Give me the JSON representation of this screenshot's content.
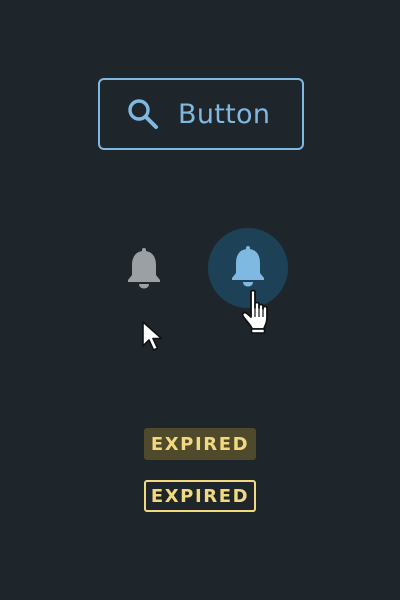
{
  "search_button": {
    "label": "Button",
    "icon": "search-icon",
    "color": "#7fb9e2"
  },
  "bells": [
    {
      "icon": "bell-icon",
      "state": "default",
      "color": "#9aa0a4"
    },
    {
      "icon": "bell-icon",
      "state": "hover",
      "color": "#7fb9e2",
      "highlight": "#1d4258"
    }
  ],
  "cursors": [
    {
      "icon": "arrow-pointer-icon"
    },
    {
      "icon": "hand-pointer-icon"
    }
  ],
  "badges": [
    {
      "label": "EXPIRED",
      "style": "filled",
      "color": "#f0d97e",
      "background": "#4f4a2c"
    },
    {
      "label": "EXPIRED",
      "style": "outline",
      "color": "#f0d97e"
    }
  ],
  "colors": {
    "background": "#1f262b"
  }
}
